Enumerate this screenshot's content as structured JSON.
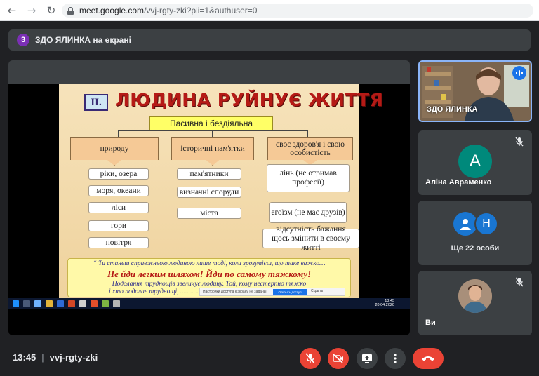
{
  "browser": {
    "url_host": "meet.google.com",
    "url_path": "/vvj-rgty-zki?pli=1&authuser=0",
    "back_icon": "arrow-left-icon",
    "forward_icon": "arrow-right-icon",
    "reload_icon": "reload-icon"
  },
  "banner": {
    "badge": "3",
    "text": "ЗДО ЯЛИНКА на екрані"
  },
  "slide": {
    "number": "II.",
    "title": "ЛЮДИНА РУЙНУЄ ЖИТТЯ",
    "center": "Пасивна  і  бездіяльна",
    "categories": [
      "природу",
      "історичні пам'ятки",
      "своє здоров'я  і  свою особистість"
    ],
    "col1": [
      "ріки, озера",
      "моря, океани",
      "ліси",
      "гори",
      "повітря"
    ],
    "col2": [
      "пам'ятники",
      "визначні споруди",
      "міста"
    ],
    "col3": [
      "лінь (не отримав професії)",
      "егоїзм (не має друзів)",
      "відсутність бажання щось змінити в своєму житті"
    ],
    "quote_line1": "“ Ти станеш справжньою людиною лише тоді, коли зрозумієш, що таке важко…",
    "quote_line2": "Не йди легким шляхом!     Йди по самому тяжкому!",
    "quote_line3": "Подолання труднощів звеличує людину. Той, кому нестерпно тяжко",
    "quote_line4": "і хто подолає труднощі, .................. оту серед інших людей…” (2, 306)",
    "notify_text": "Настройки доступа к экрану не заданы",
    "notify_button": "Открыть доступ",
    "notify_hide": "Скрыть",
    "taskbar_time": "13:45",
    "taskbar_date": "20.04.2020"
  },
  "participants": [
    {
      "name": "ЗДО ЯЛИНКА",
      "status": "speaking"
    },
    {
      "name": "Аліна Авраменко",
      "initial": "А",
      "status": "muted"
    },
    {
      "name": "Ще 22 особи",
      "initial": "Н"
    },
    {
      "name": "Ви",
      "status": "muted"
    }
  ],
  "bottom": {
    "time": "13:45",
    "meeting_code": "vvj-rgty-zki"
  },
  "colors": {
    "accent_red": "#ea4335",
    "tile_bg": "#3c4043",
    "page_bg": "#202124",
    "active_border": "#8ab4f8"
  }
}
